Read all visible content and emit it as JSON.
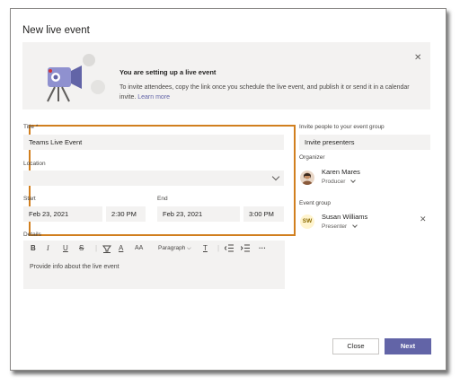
{
  "dialog": {
    "title": "New live event",
    "close_icon": "close-icon"
  },
  "banner": {
    "heading": "You are setting up a live event",
    "text": "To invite attendees, copy the link once you schedule the live event, and publish it or send it in a calendar invite.",
    "link": "Learn more",
    "art_icon": "camera-illustration"
  },
  "form": {
    "title_label": "Title *",
    "title_value": "Teams Live Event",
    "location_label": "Location",
    "location_value": "",
    "start_label": "Start",
    "start_date": "Feb 23, 2021",
    "start_time": "2:30 PM",
    "end_label": "End",
    "end_date": "Feb 23, 2021",
    "end_time": "3:00 PM",
    "highlight_color": "#d17f1f"
  },
  "details": {
    "label": "Details",
    "placeholder": "Provide info about the live event",
    "toolbar": {
      "bold": "B",
      "italic": "I",
      "underline": "U",
      "strike": "S",
      "highlight_icon": "highlighter-icon",
      "font_color": "A",
      "font_size": "AA",
      "paragraph": "Paragraph",
      "clear_format": "T",
      "outdent_icon": "outdent-icon",
      "indent_icon": "indent-icon",
      "more": "···"
    }
  },
  "invite": {
    "label": "Invite people to your event group",
    "placeholder": "Invite presenters"
  },
  "organizer": {
    "label": "Organizer",
    "name": "Karen Mares",
    "role": "Producer"
  },
  "event_group": {
    "label": "Event group",
    "name": "Susan Williams",
    "initials": "SW",
    "role": "Presenter",
    "remove_icon": "close-icon"
  },
  "footer": {
    "close_label": "Close",
    "next_label": "Next"
  },
  "colors": {
    "accent": "#6264a7",
    "highlight": "#d17f1f",
    "field_bg": "#f3f2f1"
  }
}
